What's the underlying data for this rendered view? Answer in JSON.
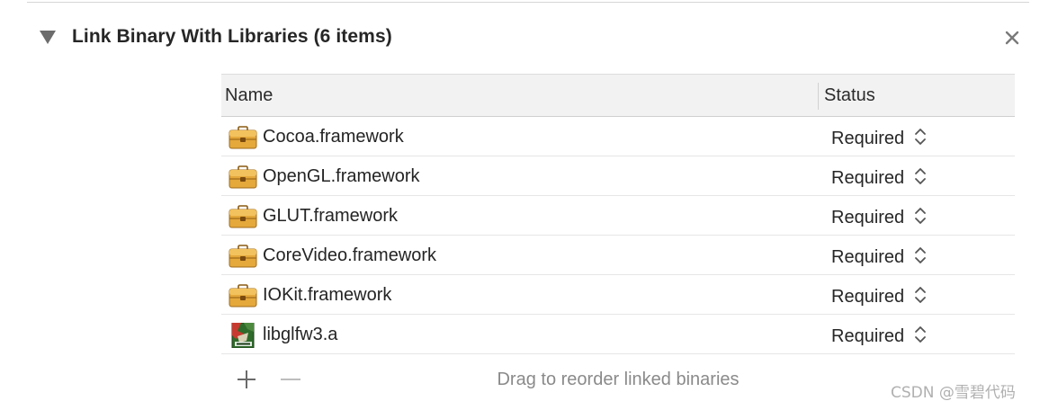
{
  "section": {
    "title": "Link Binary With Libraries (6 items)"
  },
  "table": {
    "columns": {
      "name": "Name",
      "status": "Status"
    },
    "rows": [
      {
        "name": "Cocoa.framework",
        "status": "Required",
        "icon": "framework-toolbox-icon"
      },
      {
        "name": "OpenGL.framework",
        "status": "Required",
        "icon": "framework-toolbox-icon"
      },
      {
        "name": "GLUT.framework",
        "status": "Required",
        "icon": "framework-toolbox-icon"
      },
      {
        "name": "CoreVideo.framework",
        "status": "Required",
        "icon": "framework-toolbox-icon"
      },
      {
        "name": "IOKit.framework",
        "status": "Required",
        "icon": "framework-toolbox-icon"
      },
      {
        "name": "libglfw3.a",
        "status": "Required",
        "icon": "static-library-archive-icon"
      }
    ],
    "footer_hint": "Drag to reorder linked binaries"
  },
  "watermark": "CSDN @雪碧代码",
  "colors": {
    "header_bg": "#f2f2f2",
    "framework_icon": "#e0a63a",
    "hint_text": "#8a8a8a"
  }
}
